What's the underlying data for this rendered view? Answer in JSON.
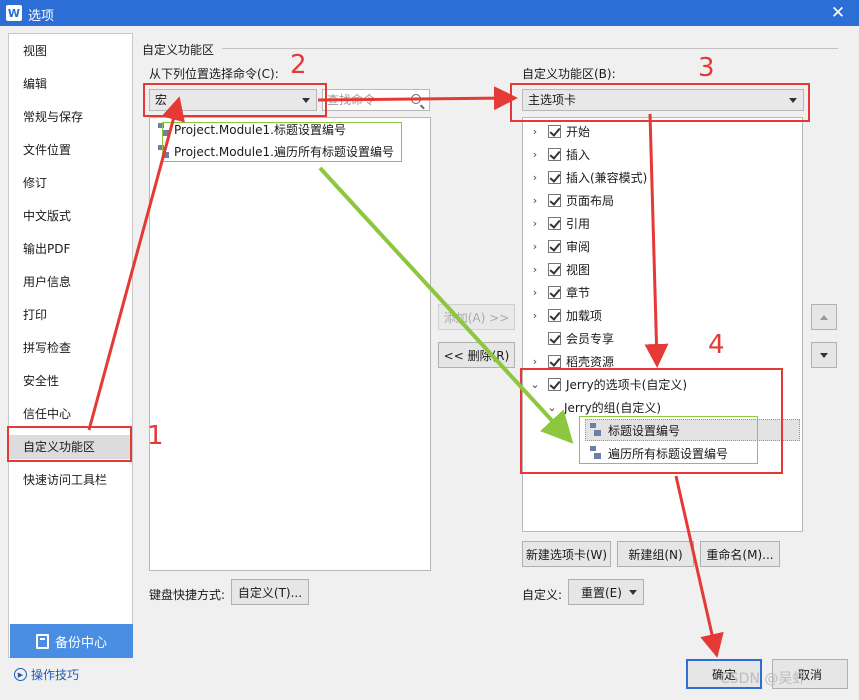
{
  "window": {
    "title": "选项",
    "app_icon_letter": "W",
    "close_glyph": "✕"
  },
  "sidebar": {
    "items": [
      "视图",
      "编辑",
      "常规与保存",
      "文件位置",
      "修订",
      "中文版式",
      "输出PDF",
      "用户信息",
      "打印",
      "拼写检查",
      "安全性",
      "信任中心",
      "自定义功能区",
      "快速访问工具栏"
    ],
    "active_index": 12,
    "backup_label": "备份中心",
    "tips_label": "操作技巧"
  },
  "main": {
    "section_title": "自定义功能区",
    "left": {
      "choose_label": "从下列位置选择命令(C):",
      "source_value": "宏",
      "search_placeholder": "查找命令",
      "commands": [
        "Project.Module1.标题设置编号",
        "Project.Module1.遍历所有标题设置编号"
      ],
      "shortcut_label": "键盘快捷方式:",
      "customize_shortcut_label": "自定义(T)..."
    },
    "middle": {
      "add_label": "添加(A) >>",
      "remove_label": "<< 删除(R)"
    },
    "right": {
      "ribbon_label": "自定义功能区(B):",
      "ribbon_value": "主选项卡",
      "tabs": [
        "开始",
        "插入",
        "插入(兼容模式)",
        "页面布局",
        "引用",
        "审阅",
        "视图",
        "章节",
        "加载项",
        "会员专享",
        "稻壳资源",
        "Jerry的选项卡(自定义)"
      ],
      "group_label": "Jerry的组(自定义)",
      "group_commands": [
        "标题设置编号",
        "遍历所有标题设置编号"
      ],
      "new_tab_label": "新建选项卡(W)",
      "new_group_label": "新建组(N)",
      "rename_label": "重命名(M)...",
      "customize_label": "自定义:",
      "reset_label": "重置(E)"
    }
  },
  "footer": {
    "ok_label": "确定",
    "cancel_label": "取消"
  },
  "annotations": {
    "step1": "1",
    "step2": "2",
    "step3": "3",
    "step4": "4"
  },
  "watermark": "CSDN @吴虾",
  "colors": {
    "accent": "#2b6fd6",
    "annotation_red": "#e53935",
    "annotation_green": "#8dc63f"
  }
}
